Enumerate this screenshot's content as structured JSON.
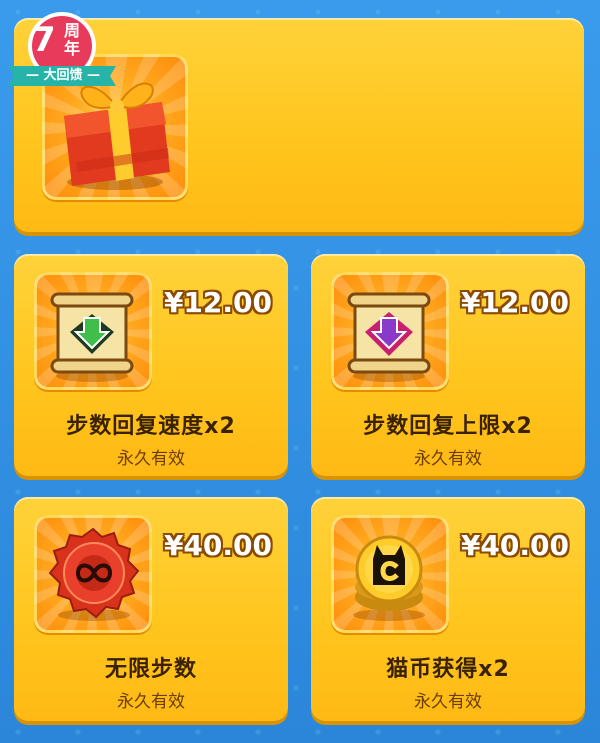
{
  "badge": {
    "number": "7",
    "top_text": "周",
    "mid_text": "年",
    "ribbon_text": "— 大回馈 —"
  },
  "colors": {
    "card": "#ffc61e",
    "price_outline": "#8a4a00",
    "title": "#3a2200",
    "background": "#2f8fe0"
  },
  "featured": {
    "icon": "gift-box-icon"
  },
  "items": [
    {
      "icon": "green-arrow-scroll-icon",
      "price": "¥12.00",
      "title": "步数回复速度x2",
      "subtitle": "永久有效"
    },
    {
      "icon": "purple-arrow-scroll-icon",
      "price": "¥12.00",
      "title": "步数回复上限x2",
      "subtitle": "永久有效"
    },
    {
      "icon": "infinity-seal-icon",
      "price": "¥40.00",
      "title": "无限步数",
      "subtitle": "永久有效"
    },
    {
      "icon": "cat-coin-icon",
      "price": "¥40.00",
      "title": "猫币获得x2",
      "subtitle": "永久有效"
    }
  ]
}
